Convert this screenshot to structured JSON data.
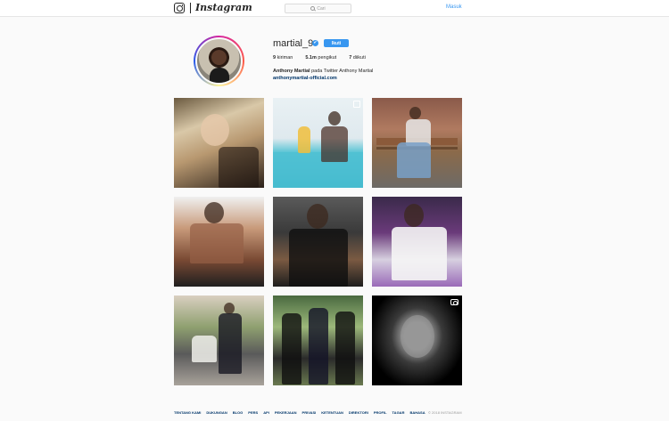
{
  "nav": {
    "brand": "Instagram",
    "search_placeholder": "Cari",
    "login_label": "Masuk"
  },
  "profile": {
    "username": "martial_9",
    "verified": "✔",
    "follow_label": "Ikuti",
    "stats": [
      {
        "count": "9",
        "label": "kiriman"
      },
      {
        "count": "5.1m",
        "label": "pengikut"
      },
      {
        "count": "7",
        "label": "diikuti"
      }
    ],
    "full_name": "Anthony Martial",
    "bio": "pada Twitter Anthony Martial",
    "link": "anthonymartial-official.com"
  },
  "posts": [
    {
      "name": "post-1",
      "type": "image"
    },
    {
      "name": "post-2",
      "type": "carousel"
    },
    {
      "name": "post-3",
      "type": "image"
    },
    {
      "name": "post-4",
      "type": "image"
    },
    {
      "name": "post-5",
      "type": "image"
    },
    {
      "name": "post-6",
      "type": "image"
    },
    {
      "name": "post-7",
      "type": "image"
    },
    {
      "name": "post-8",
      "type": "image"
    },
    {
      "name": "post-9",
      "type": "video"
    }
  ],
  "footer": {
    "links": [
      "TENTANG KAMI",
      "DUKUNGAN",
      "BLOG",
      "PERS",
      "API",
      "PEKERJAAN",
      "PRIVASI",
      "KETENTUAN",
      "DIREKTORI",
      "PROFIL",
      "TAGAR",
      "BAHASA"
    ],
    "copyright": "© 2018 INSTAGRAM"
  },
  "colors": {
    "accent": "#3897f0",
    "link": "#003569",
    "background": "#fafafa"
  }
}
